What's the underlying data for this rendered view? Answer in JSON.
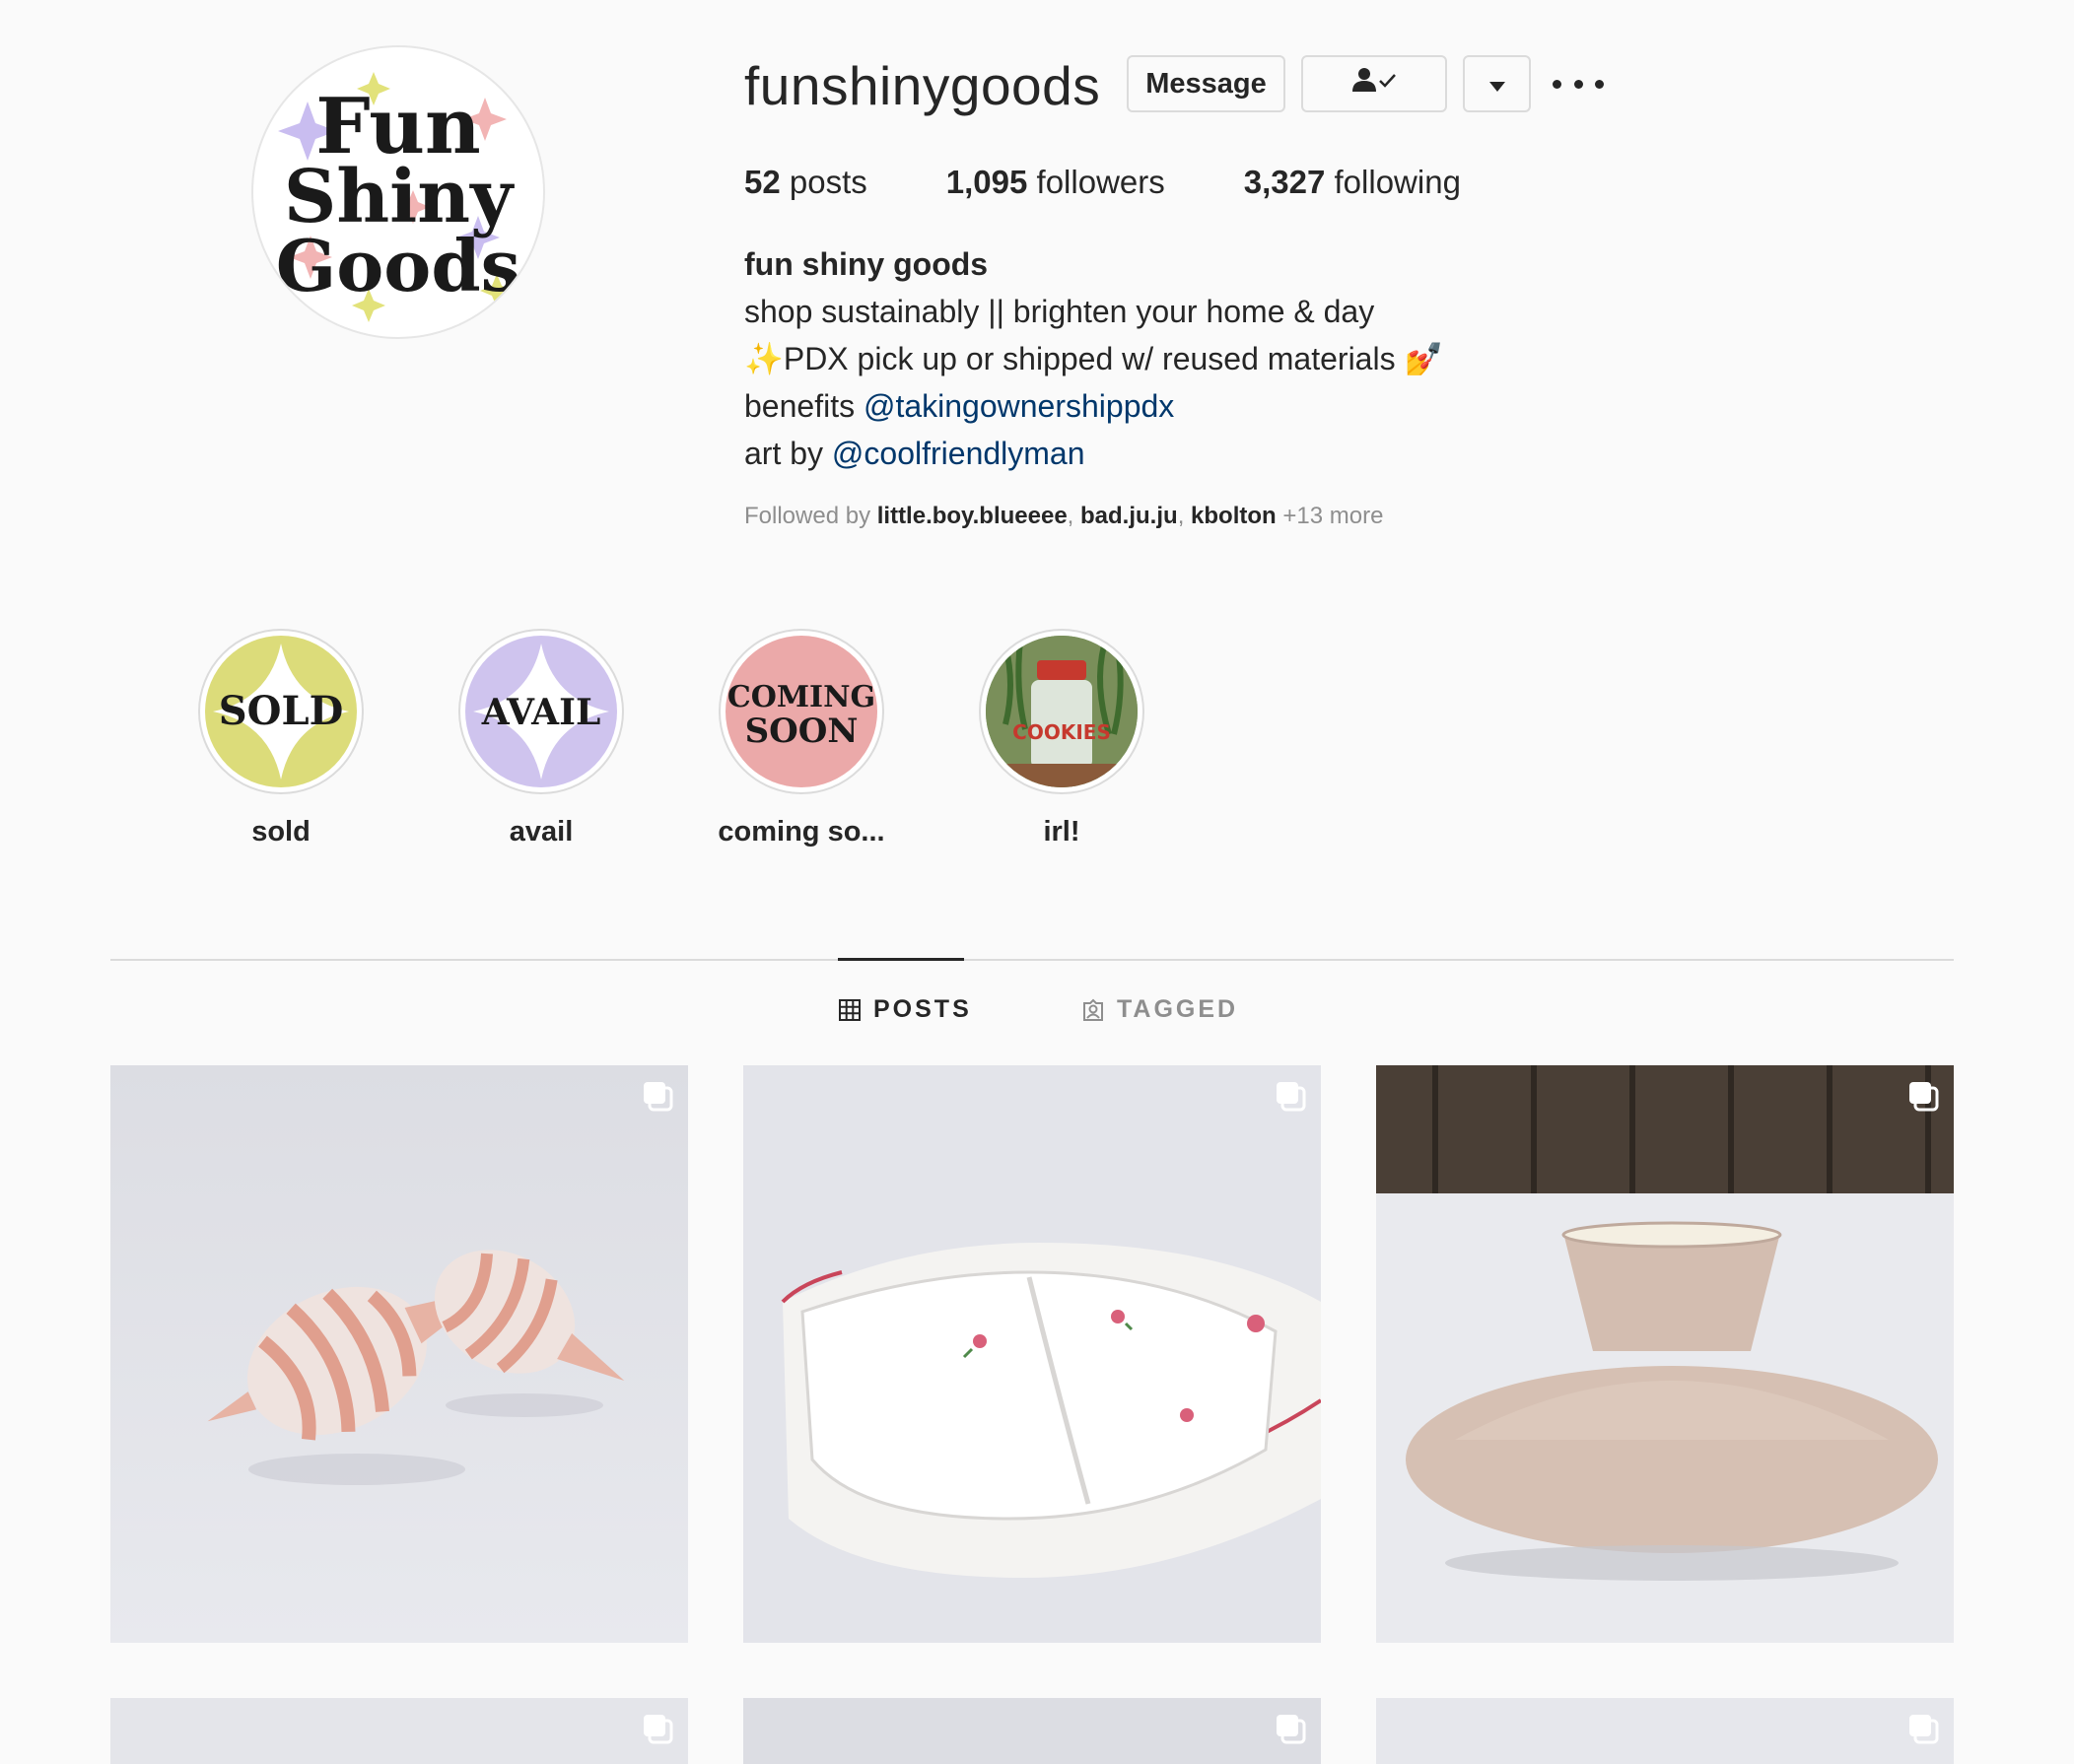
{
  "profile": {
    "username": "funshinygoods",
    "avatar_text": [
      "Fun",
      "Shiny",
      "Goods"
    ],
    "buttons": {
      "message": "Message",
      "following_icon": "person-check-icon",
      "dropdown_icon": "caret-down-icon",
      "more_icon": "more-options-icon"
    },
    "stats": {
      "posts_count": "52",
      "posts_label": "posts",
      "followers_count": "1,095",
      "followers_label": "followers",
      "following_count": "3,327",
      "following_label": "following"
    },
    "bio": {
      "full_name": "fun shiny goods",
      "line1": "shop sustainably || brighten your home & day",
      "line2_emoji_start": "✨",
      "line2_text": "PDX pick up or shipped w/ reused materials ",
      "line2_emoji_end": "💅",
      "line3_prefix": "benefits ",
      "line3_link": "@takingownershippdx",
      "line4_prefix": "art by ",
      "line4_link": "@coolfriendlyman"
    },
    "followed_by": {
      "prefix": "Followed by ",
      "user1": "little.boy.blueeee",
      "sep1": ", ",
      "user2": "bad.ju.ju",
      "sep2": ", ",
      "user3": "kbolton",
      "more": " +13 more"
    }
  },
  "highlights": [
    {
      "label": "sold",
      "cover_text": "SOLD",
      "color": "#dcdc7a"
    },
    {
      "label": "avail",
      "cover_text": "AVAIL",
      "color": "#cfc4ee"
    },
    {
      "label": "coming so...",
      "cover_text": "COMING SOON",
      "color": "#eba9a9"
    },
    {
      "label": "irl!",
      "cover_text": "COOKIES",
      "color": "#6b8a4e"
    }
  ],
  "tabs": {
    "posts": "POSTS",
    "tagged": "TAGGED"
  },
  "posts": [
    {
      "subject": "seashell salt and pepper shakers",
      "icon": "carousel-icon"
    },
    {
      "subject": "floral divided dish",
      "icon": "carousel-icon"
    },
    {
      "subject": "textured pink vase",
      "icon": "carousel-icon"
    },
    {
      "subject": "snow photo",
      "icon": "carousel-icon"
    },
    {
      "subject": "snow photo",
      "icon": "carousel-icon"
    },
    {
      "subject": "snow photo",
      "icon": "carousel-icon"
    }
  ]
}
